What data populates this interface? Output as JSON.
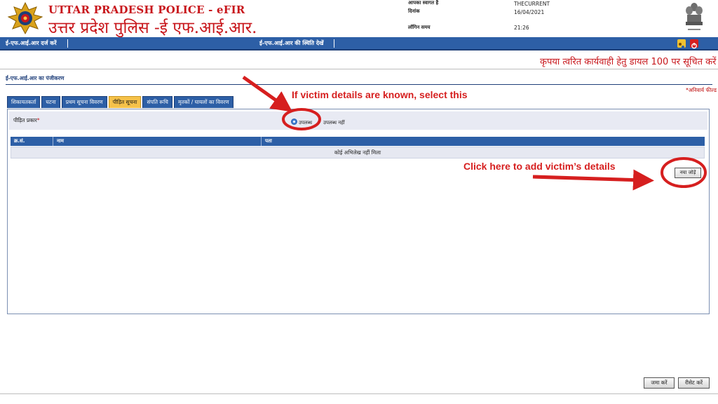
{
  "header": {
    "title_en": "UTTAR PRADESH POLICE - eFIR",
    "title_hi": "उत्तर प्रदेश पुलिस -ई एफ.आई.आर.",
    "welcome_label": "आपका स्वागत है",
    "username": "THECURRENT",
    "date_label": "दिनांक",
    "date_value": "16/04/2021",
    "login_time_label": "लॉगिन समय",
    "login_time_value": "21:26",
    "logo_icon": "up-police-logo-icon",
    "emblem_icon": "ashoka-emblem-icon"
  },
  "navbar": {
    "register_fir": "ई-एफ.आई.आर दर्ज करें",
    "fir_status": "ई-एफ.आई.आर की स्थिति देखें",
    "icons": [
      "settings-icon",
      "power-icon"
    ],
    "color": "#2d5fa6"
  },
  "marquee": "कृपया त्वरित कार्यवाही हेतु डायल 100 पर सूचित करें",
  "section": {
    "title": "ई-एफ.आई.आर का पंजीकरण",
    "mandatory_note": "*अनिवार्य फील्ड"
  },
  "tabs": [
    {
      "label": "शिकायतकर्ता",
      "active": false
    },
    {
      "label": "घटना",
      "active": false
    },
    {
      "label": "प्रथम सूचना विवरण",
      "active": false
    },
    {
      "label": "पीड़ित सूचना",
      "active": true
    },
    {
      "label": "संपति रूचि",
      "active": false
    },
    {
      "label": "मृतकों / घायलों का विवरण",
      "active": false
    }
  ],
  "victim": {
    "label": "पीड़ित प्रकार",
    "required_mark": "*",
    "option_available": "उपलब्ध",
    "option_not_available": "उपलब्ध नहीं",
    "selected": "उपलब्ध"
  },
  "grid": {
    "columns": [
      "क्र.सं.",
      "नाम",
      "पता"
    ],
    "empty_message": "कोई अभिलेख नहीं मिला"
  },
  "add_button": "नया जोड़ें",
  "footer_buttons": {
    "submit": "जमा करें",
    "reset": "रीसेट करें"
  },
  "annotations": {
    "select_hint": "If victim details are known, select this",
    "add_hint": "Click here to add victim’s details",
    "color": "#d61f1f"
  }
}
